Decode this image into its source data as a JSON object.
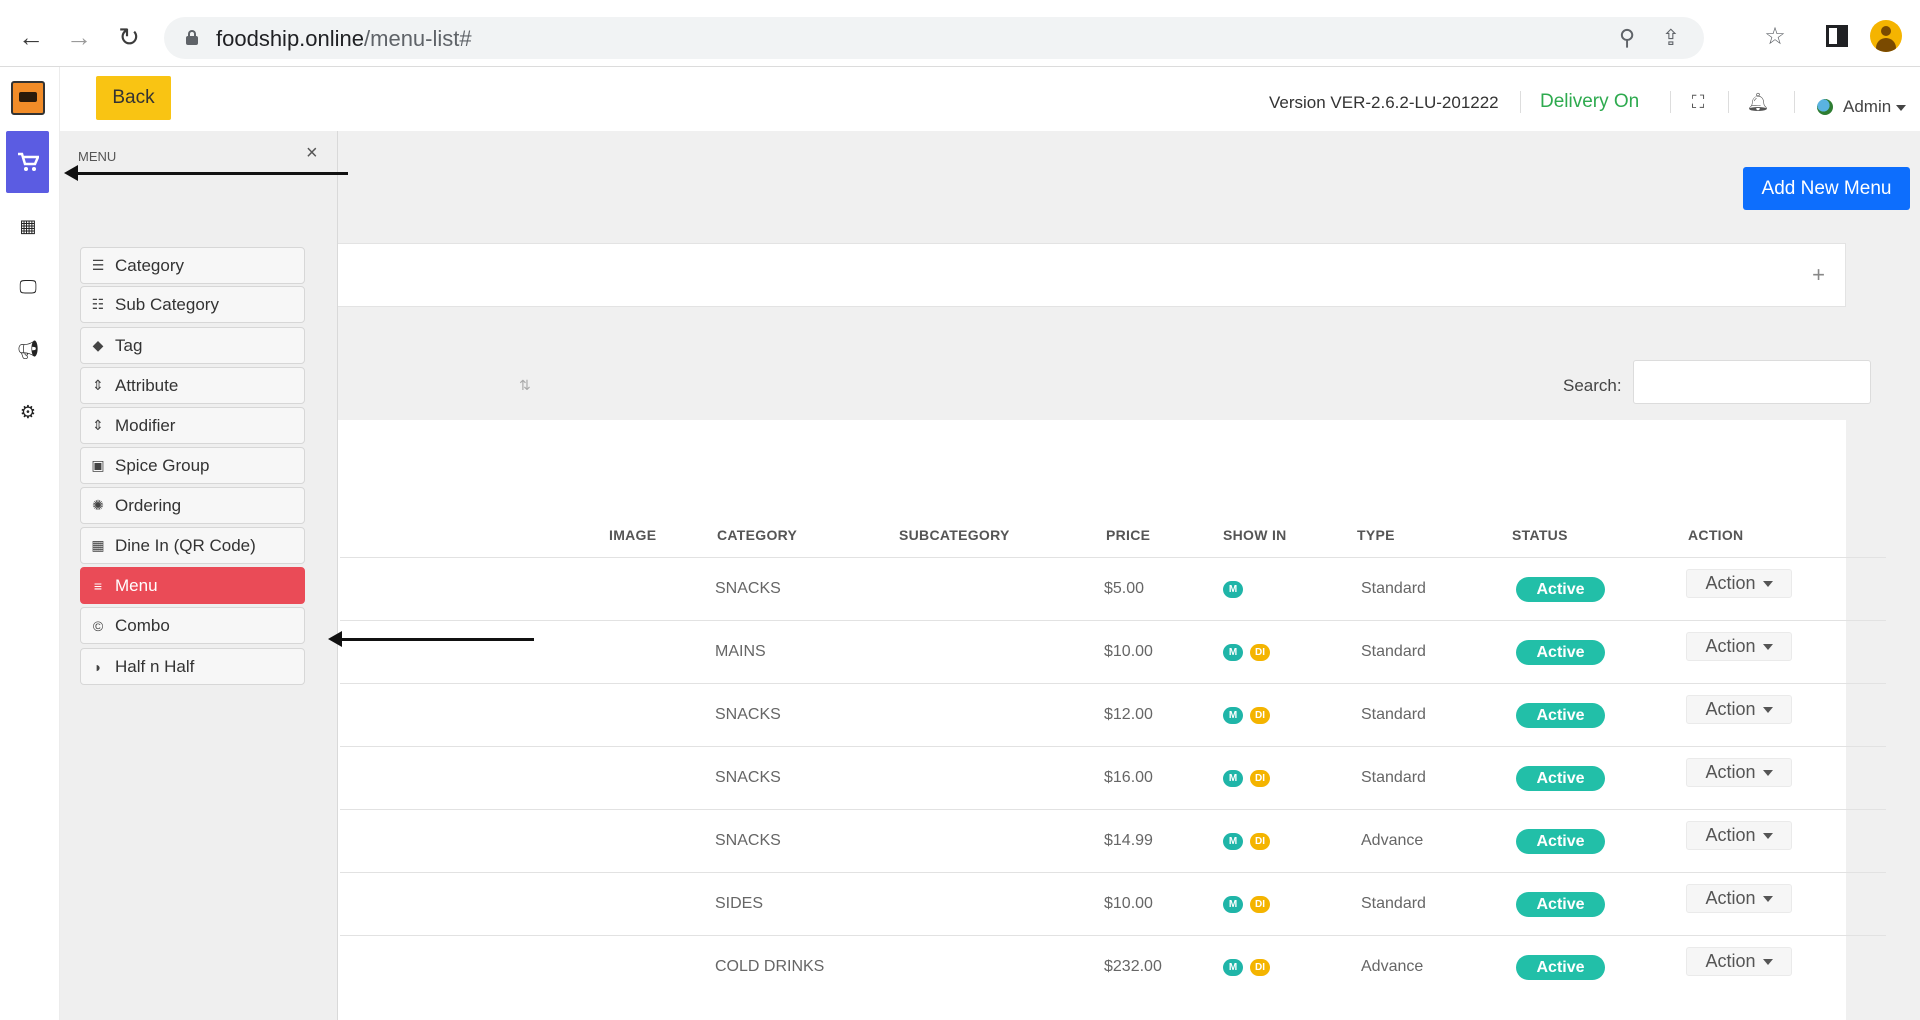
{
  "browser": {
    "url_host": "foodship.online",
    "url_path": "/menu-list#"
  },
  "topbar": {
    "back_label": "Back",
    "version": "Version VER-2.6.2-LU-201222",
    "delivery": "Delivery On",
    "admin": "Admin"
  },
  "drawer": {
    "title": "MENU",
    "close": "×",
    "items": [
      {
        "label": "Category",
        "icon": "list-ordered-icon"
      },
      {
        "label": "Sub Category",
        "icon": "list-icon"
      },
      {
        "label": "Tag",
        "icon": "tag-icon"
      },
      {
        "label": "Attribute",
        "icon": "sort-icon"
      },
      {
        "label": "Modifier",
        "icon": "sort-icon"
      },
      {
        "label": "Spice Group",
        "icon": "image-icon"
      },
      {
        "label": "Ordering",
        "icon": "cog-icon"
      },
      {
        "label": "Dine In (QR Code)",
        "icon": "qr-icon"
      },
      {
        "label": "Menu",
        "icon": "bars-icon",
        "active": true
      },
      {
        "label": "Combo",
        "icon": "copyright-icon"
      },
      {
        "label": "Half n Half",
        "icon": "half-icon"
      }
    ]
  },
  "main": {
    "add_button": "Add New Menu",
    "search_label": "Search:",
    "columns": [
      "IMAGE",
      "CATEGORY",
      "SUBCATEGORY",
      "PRICE",
      "SHOW IN",
      "TYPE",
      "STATUS",
      "ACTION"
    ],
    "badges": {
      "m": "M",
      "di": "DI"
    },
    "rows": [
      {
        "category": "SNACKS",
        "price": "$5.00",
        "show_in": [
          "M"
        ],
        "type": "Standard",
        "status": "Active",
        "action": "Action"
      },
      {
        "category": "MAINS",
        "price": "$10.00",
        "show_in": [
          "M",
          "DI"
        ],
        "type": "Standard",
        "status": "Active",
        "action": "Action"
      },
      {
        "category": "SNACKS",
        "price": "$12.00",
        "show_in": [
          "M",
          "DI"
        ],
        "type": "Standard",
        "status": "Active",
        "action": "Action"
      },
      {
        "category": "SNACKS",
        "price": "$16.00",
        "show_in": [
          "M",
          "DI"
        ],
        "type": "Standard",
        "status": "Active",
        "action": "Action"
      },
      {
        "category": "SNACKS",
        "price": "$14.99",
        "show_in": [
          "M",
          "DI"
        ],
        "type": "Advance",
        "status": "Active",
        "action": "Action"
      },
      {
        "category": "SIDES",
        "price": "$10.00",
        "show_in": [
          "M",
          "DI"
        ],
        "type": "Standard",
        "status": "Active",
        "action": "Action"
      },
      {
        "category": "COLD DRINKS",
        "price": "$232.00",
        "show_in": [
          "M",
          "DI"
        ],
        "type": "Advance",
        "status": "Active",
        "action": "Action"
      }
    ]
  },
  "colors": {
    "accent": "#0d6efd",
    "back": "#f9c413",
    "active_menu": "#ea4b57",
    "status": "#22bfa8",
    "rail_active": "#5b5ce2",
    "delivery": "#2eaa4f"
  }
}
